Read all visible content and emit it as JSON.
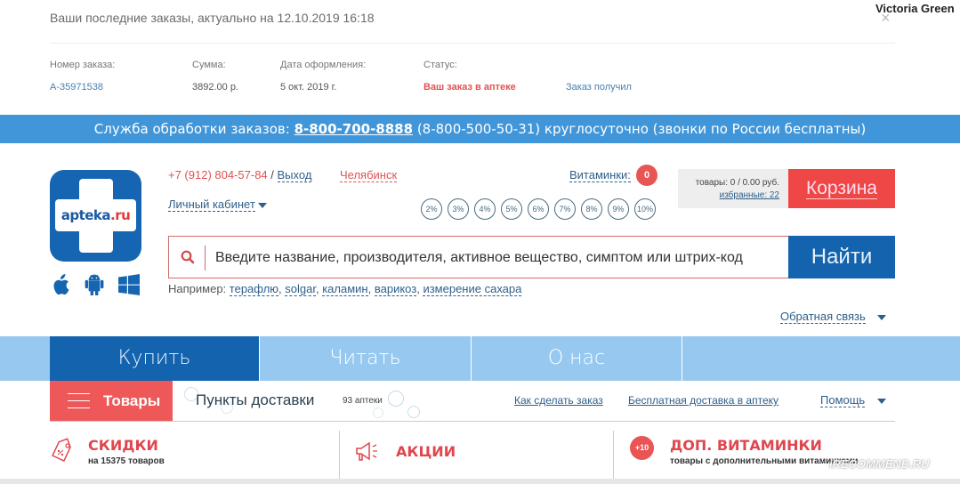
{
  "overlay_user": "Victoria Green",
  "orders": {
    "title": "Ваши последние заказы, актуально на 12.10.2019 16:18",
    "close_icon": "×",
    "columns": {
      "number": "Номер заказа:",
      "sum": "Сумма:",
      "date": "Дата оформления:",
      "status": "Статус:"
    },
    "rows": [
      {
        "number": "А-35971538",
        "sum": "3892.00 р.",
        "date": "5 окт. 2019 г.",
        "status": "Ваш заказ в аптеке",
        "action": "Заказ получил"
      }
    ]
  },
  "service_bar": {
    "prefix": "Служба обработки заказов: ",
    "phone": "8-800-700-8888",
    "suffix": " (8-800-500-50-31) круглосуточно (звонки по России бесплатны)"
  },
  "logo": {
    "text_main": "apteka",
    "text_accent": ".ru"
  },
  "app_icons": [
    "apple-icon",
    "android-icon",
    "windows-icon"
  ],
  "header": {
    "phone": "+7 (912) 804-57-84",
    "slash": " / ",
    "logout": "Выход",
    "city": "Челябинск",
    "cabinet": "Личный кабинет",
    "vitaminki_label": "Витаминки:",
    "vitaminki_count": "0",
    "percents": [
      "2%",
      "3%",
      "4%",
      "5%",
      "6%",
      "7%",
      "8%",
      "9%",
      "10%"
    ]
  },
  "cart": {
    "goods": "товары: 0 / 0.00 руб.",
    "favorites": "избранные: 22",
    "button": "Корзина"
  },
  "search": {
    "placeholder": "Введите название, производителя, активное вещество, симптом или штрих-код",
    "value": "",
    "button": "Найти"
  },
  "examples": {
    "label": "Например: ",
    "items": [
      "терафлю",
      "solgar",
      "каламин",
      "варикоз",
      "измерение сахара"
    ]
  },
  "feedback": "Обратная связь",
  "nav": {
    "tabs": [
      {
        "label": "Купить",
        "active": true
      },
      {
        "label": "Читать",
        "active": false
      },
      {
        "label": "О нас",
        "active": false
      }
    ]
  },
  "subnav": {
    "tovary": "Товары",
    "punkty": "Пункты доставки",
    "apteki": "93 аптеки",
    "links": [
      "Как сделать заказ",
      "Бесплатная доставка в аптеку"
    ],
    "help": "Помощь"
  },
  "promos": [
    {
      "title": "СКИДКИ",
      "subtitle": "на 15375 товаров",
      "icon": "price-tag-icon"
    },
    {
      "title": "АКЦИИ",
      "subtitle": "",
      "icon": "megaphone-icon"
    },
    {
      "title": "ДОП. ВИТАМИНКИ",
      "subtitle": "товары с дополнительными витаминками",
      "icon": "plus10-badge",
      "badge": "+10"
    }
  ],
  "watermark": "iRECOMMEND.RU",
  "colors": {
    "brand_blue": "#1363ae",
    "service_bar": "#4196d9",
    "nav_light": "#97c9f0",
    "accent_red": "#ef4646",
    "link_blue": "#2e5f8a"
  }
}
